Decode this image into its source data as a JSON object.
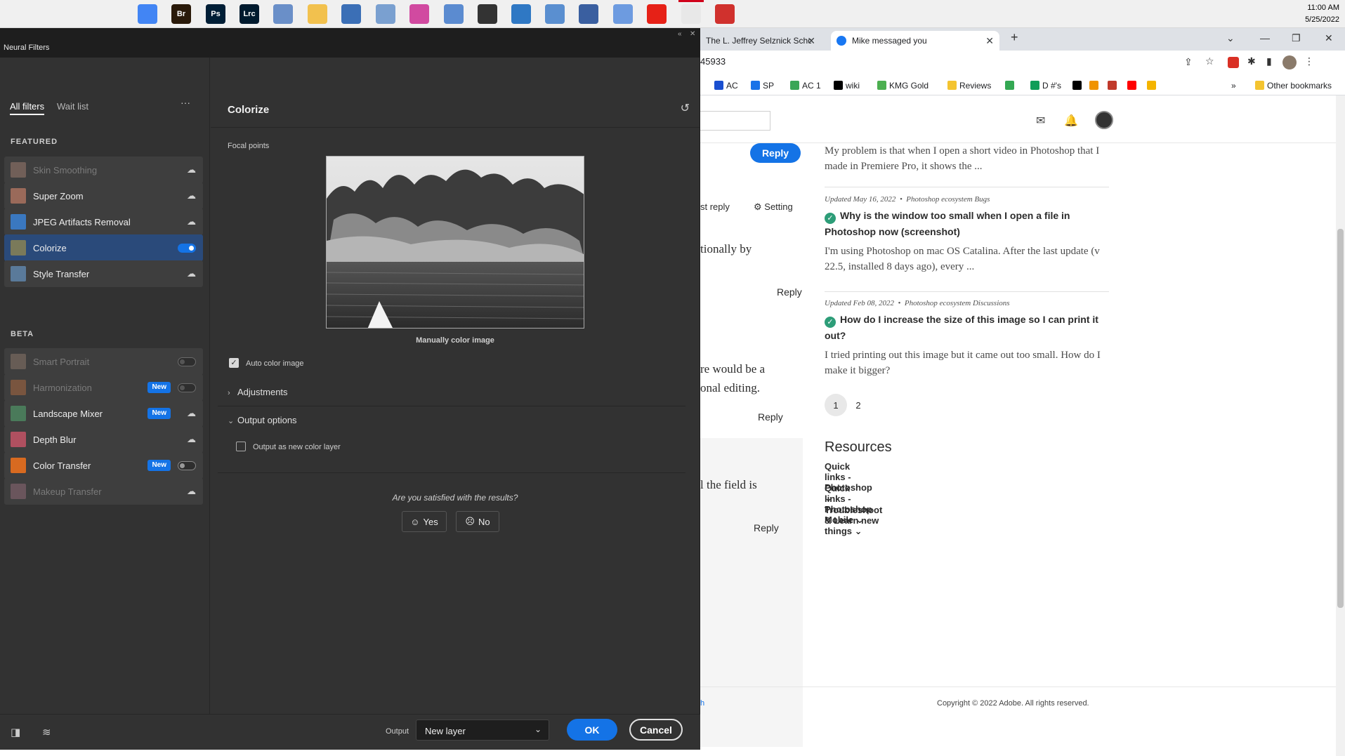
{
  "taskbar": {
    "apps": [
      {
        "name": "windows-start-icon",
        "label": "",
        "color": "#000000"
      },
      {
        "name": "search-icon",
        "label": "",
        "color": "#000000"
      },
      {
        "name": "cortana-icon",
        "label": "",
        "color": "#000000"
      },
      {
        "name": "task-view-icon",
        "label": "",
        "color": "#000000"
      },
      {
        "name": "chrome-icon",
        "label": "",
        "color": "#4285f4"
      },
      {
        "name": "bridge-icon",
        "label": "Br",
        "color": "#2a1a0a"
      },
      {
        "name": "photoshop-icon",
        "label": "Ps",
        "color": "#001e36"
      },
      {
        "name": "lightroom-classic-icon",
        "label": "Lrc",
        "color": "#001a2e"
      },
      {
        "name": "app-icon",
        "label": "",
        "color": "#6a8fc8"
      },
      {
        "name": "file-explorer-icon",
        "label": "",
        "color": "#f2c14e"
      },
      {
        "name": "calculator-icon",
        "label": "",
        "color": "#3b6fb6"
      },
      {
        "name": "photos-icon",
        "label": "",
        "color": "#7aa0d0"
      },
      {
        "name": "color-app-icon",
        "label": "",
        "color": "#d14aa0"
      },
      {
        "name": "app-window-icon",
        "label": "",
        "color": "#5b8bd0"
      },
      {
        "name": "clock-app-icon",
        "label": "",
        "color": "#333333"
      },
      {
        "name": "app-icon",
        "label": "",
        "color": "#2f78c4"
      },
      {
        "name": "app-icon",
        "label": "",
        "color": "#5a8fd0"
      },
      {
        "name": "app-icon",
        "label": "",
        "color": "#3a5fa0"
      },
      {
        "name": "document-icon",
        "label": "",
        "color": "#6d9be0"
      },
      {
        "name": "youtube-music-icon",
        "label": "",
        "color": "#e62117"
      },
      {
        "name": "app-icon",
        "label": "",
        "color": "#e8e8e8"
      },
      {
        "name": "app-icon",
        "label": "",
        "color": "#d0312d"
      }
    ],
    "time": "11:00 AM",
    "date": "5/25/2022"
  },
  "neural_filters": {
    "window_title": "Neural Filters",
    "tabs": {
      "all": "All filters",
      "waitlist": "Wait list"
    },
    "more": "···",
    "featured_heading": "FEATURED",
    "beta_heading": "BETA",
    "featured": [
      {
        "label": "Skin Smoothing",
        "state": "cloud",
        "disabled": true,
        "thumb": "#b08878"
      },
      {
        "label": "Super Zoom",
        "state": "cloud",
        "disabled": false,
        "thumb": "#9a6a5a"
      },
      {
        "label": "JPEG Artifacts Removal",
        "state": "cloud",
        "disabled": false,
        "thumb": "#3a78c0"
      },
      {
        "label": "Colorize",
        "state": "on",
        "disabled": false,
        "thumb": "#7a7a5a"
      },
      {
        "label": "Style Transfer",
        "state": "cloud",
        "disabled": false,
        "thumb": "#5a7a9a"
      }
    ],
    "beta": [
      {
        "label": "Smart Portrait",
        "state": "off",
        "disabled": true,
        "thumb": "#9a8070",
        "badge": ""
      },
      {
        "label": "Harmonization",
        "state": "off",
        "disabled": true,
        "thumb": "#c07040",
        "badge": "New"
      },
      {
        "label": "Landscape Mixer",
        "state": "cloud",
        "disabled": false,
        "thumb": "#4a7a5a",
        "badge": "New"
      },
      {
        "label": "Depth Blur",
        "state": "cloud",
        "disabled": false,
        "thumb": "#b05060",
        "badge": ""
      },
      {
        "label": "Color Transfer",
        "state": "offdark",
        "disabled": false,
        "thumb": "#d86a20",
        "badge": "New"
      },
      {
        "label": "Makeup Transfer",
        "state": "cloud",
        "disabled": true,
        "thumb": "#a07080",
        "badge": ""
      }
    ],
    "panel_title": "Colorize",
    "focal_points": "Focal points",
    "manual_label": "Manually color image",
    "auto_color": "Auto color image",
    "adjustments": "Adjustments",
    "output_options": "Output options",
    "output_new_layer": "Output as new color layer",
    "satisfied": "Are you satisfied with the results?",
    "yes": "Yes",
    "no": "No",
    "output_label": "Output",
    "output_value": "New layer",
    "ok": "OK",
    "cancel": "Cancel"
  },
  "chrome": {
    "tabs": [
      {
        "title": "The L. Jeffrey Selznick School of F",
        "active": false
      },
      {
        "title": "Mike messaged you",
        "active": true
      }
    ],
    "new_tab": "+",
    "url": "45933",
    "bookmarks": [
      {
        "label": "AC",
        "color": "#1a4fd0"
      },
      {
        "label": "SP",
        "color": "#1a73e8"
      },
      {
        "label": "AC 1",
        "color": "#3aa657"
      },
      {
        "label": "wiki",
        "color": "#000000"
      },
      {
        "label": "KMG Gold",
        "color": "#4caf50"
      },
      {
        "label": "Reviews",
        "color": "#f4c430"
      },
      {
        "label": "",
        "color": "#34a853"
      },
      {
        "label": "D #'s",
        "color": "#0f9d58"
      },
      {
        "label": "",
        "color": "#000000"
      },
      {
        "label": "",
        "color": "#f09300"
      },
      {
        "label": "",
        "color": "#c0392b"
      },
      {
        "label": "",
        "color": "#ff0000"
      },
      {
        "label": "",
        "color": "#f4b400"
      }
    ],
    "bookmarks_more": "»",
    "other_bookmarks": "Other bookmarks"
  },
  "community": {
    "reply_button": "Reply",
    "left_fragments": [
      {
        "text": "st reply",
        "kind": "small"
      },
      {
        "text": "Setting",
        "kind": "small"
      },
      {
        "text": "tionally by",
        "kind": "body"
      },
      {
        "text": "re would be a",
        "kind": "body"
      },
      {
        "text": "onal editing.",
        "kind": "body"
      },
      {
        "text": "l the field is",
        "kind": "body"
      }
    ],
    "reply_links": [
      "Reply",
      "Reply",
      "Reply"
    ],
    "top_post_body": "My problem is that when I open a short video in Photoshop that I made in Premiere Pro, it shows the ...",
    "posts": [
      {
        "meta": "Updated May 16, 2022",
        "board": "Photoshop ecosystem Bugs",
        "title": "Why is the window too small when I open a file in Photoshop now (screenshot)",
        "body": "I'm using Photoshop on mac OS Catalina. After the last update (v 22.5, installed 8 days ago), every ..."
      },
      {
        "meta": "Updated Feb 08, 2022",
        "board": "Photoshop ecosystem Discussions",
        "title": "How do I increase the size of this image so I can print it out?",
        "body": "I tried printing out this image but it came out too small. How do I make it bigger?"
      }
    ],
    "pages": [
      "1",
      "2"
    ],
    "resources_title": "Resources",
    "resources": [
      "Quick links - Photoshop",
      "Quick links - Photoshop Mobile",
      "Troubleshoot & Learn new things"
    ],
    "footer_fragment": "h",
    "copyright": "Copyright © 2022 Adobe. All rights reserved."
  }
}
